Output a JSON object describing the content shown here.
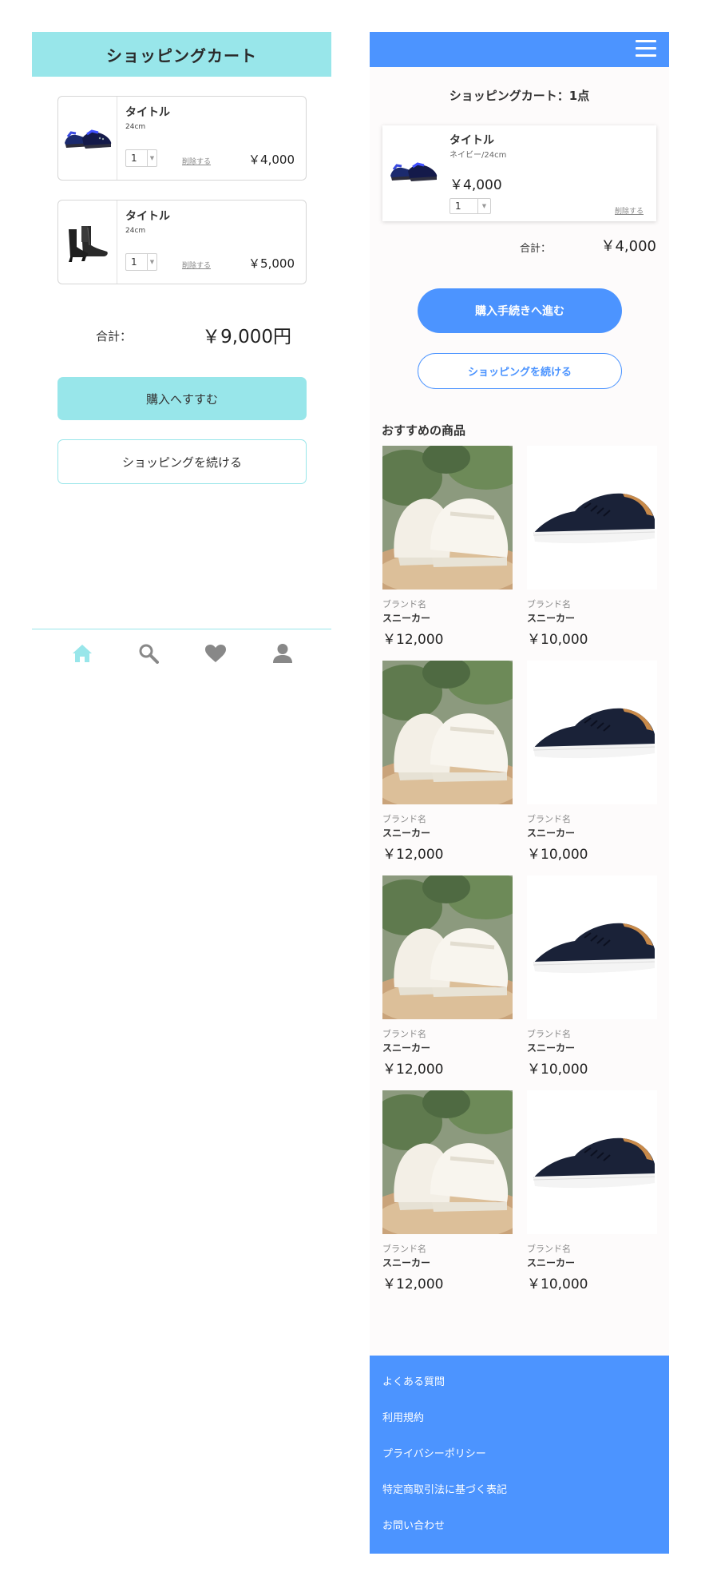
{
  "colors": {
    "left_accent": "#98e6ea",
    "right_accent": "#4c94ff"
  },
  "left": {
    "header_title": "ショッピングカート",
    "items": [
      {
        "title": "タイトル",
        "size": "24cm",
        "qty": "1",
        "delete_label": "削除する",
        "price": "￥4,000",
        "image": "blue-sneaker"
      },
      {
        "title": "タイトル",
        "size": "24cm",
        "qty": "1",
        "delete_label": "削除する",
        "price": "￥5,000",
        "image": "black-ankle-boot"
      }
    ],
    "total_label": "合計：",
    "total_value": "￥9,000円",
    "buy_button": "購入へすすむ",
    "continue_button": "ショッピングを続ける",
    "tabbar": [
      "home-icon",
      "search-icon",
      "heart-icon",
      "user-icon"
    ]
  },
  "right": {
    "cart_title": "ショッピングカート：1点",
    "item": {
      "title": "タイトル",
      "variant": "ネイビー/24cm",
      "price": "￥4,000",
      "qty": "1",
      "delete_label": "削除する",
      "image": "blue-sneaker"
    },
    "total_label": "合計：",
    "total_value": "￥4,000",
    "checkout_button": "購入手続きへ進む",
    "continue_button": "ショッピングを続ける",
    "recommend_title": "おすすめの商品",
    "products": [
      {
        "brand": "ブランド名",
        "name": "スニーカー",
        "price": "￥12,000",
        "image": "white-baby-shoes"
      },
      {
        "brand": "ブランド名",
        "name": "スニーカー",
        "price": "￥10,000",
        "image": "navy-sneaker"
      },
      {
        "brand": "ブランド名",
        "name": "スニーカー",
        "price": "￥12,000",
        "image": "white-baby-shoes"
      },
      {
        "brand": "ブランド名",
        "name": "スニーカー",
        "price": "￥10,000",
        "image": "navy-sneaker"
      },
      {
        "brand": "ブランド名",
        "name": "スニーカー",
        "price": "￥12,000",
        "image": "white-baby-shoes"
      },
      {
        "brand": "ブランド名",
        "name": "スニーカー",
        "price": "￥10,000",
        "image": "navy-sneaker"
      },
      {
        "brand": "ブランド名",
        "name": "スニーカー",
        "price": "￥12,000",
        "image": "white-baby-shoes"
      },
      {
        "brand": "ブランド名",
        "name": "スニーカー",
        "price": "￥10,000",
        "image": "navy-sneaker"
      }
    ],
    "footer_links": [
      "よくある質問",
      "利用規約",
      "プライバシーポリシー",
      "特定商取引法に基づく表記",
      "お問い合わせ"
    ]
  }
}
